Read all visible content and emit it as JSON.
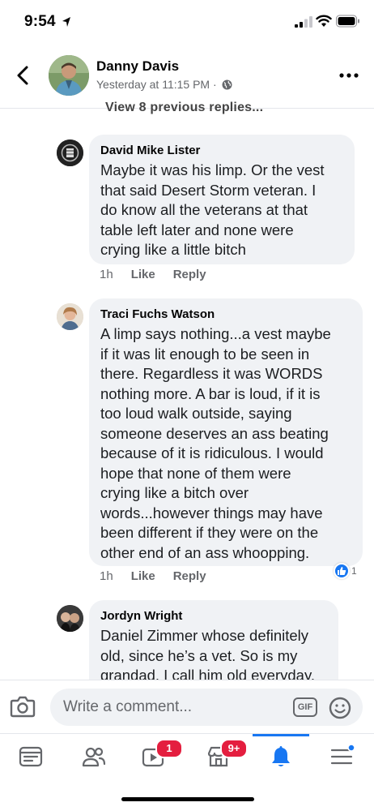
{
  "status_bar": {
    "time": "9:54"
  },
  "post": {
    "author": "Danny Davis",
    "timestamp": "Yesterday at 11:15 PM",
    "privacy_separator": "·",
    "privacy_icon": "globe-icon"
  },
  "previous_replies": "View 8 previous replies...",
  "comments": [
    {
      "author": "David Mike Lister",
      "text": "Maybe it was his limp. Or the vest\nthat said Desert Storm veteran. I\ndo know all the veterans at that\ntable left later and none were\ncrying like a little bitch",
      "time": "1h",
      "like_label": "Like",
      "reply_label": "Reply"
    },
    {
      "author": "Traci Fuchs Watson",
      "text": "A limp says nothing...a vest maybe\nif it was lit enough to be seen in\nthere. Regardless it was WORDS\nnothing more. A bar is loud, if it is\ntoo loud walk outside, saying\nsomeone deserves an ass beating\nbecause of it is ridiculous. I would\nhope that none of them were\ncrying like a bitch over\nwords...however things may have\nbeen different if they were on the\nother end of an ass whoopping.",
      "time": "1h",
      "like_label": "Like",
      "reply_label": "Reply",
      "reaction_count": "1",
      "reaction_icon": "thumbs-up-icon"
    },
    {
      "author": "Jordyn Wright",
      "text": "Daniel Zimmer whose definitely\nold, since he’s a vet. So is my\ngrandad. I call him old everyday."
    }
  ],
  "composer": {
    "placeholder": "Write a comment...",
    "gif_label": "GIF"
  },
  "tabbar": {
    "watch_badge": "1",
    "marketplace_badge": "9+",
    "active_tab": "notifications"
  },
  "colors": {
    "accent": "#1877f2",
    "badge": "#e41e3f",
    "bubble": "#f0f2f5",
    "secondary_text": "#65676b"
  }
}
